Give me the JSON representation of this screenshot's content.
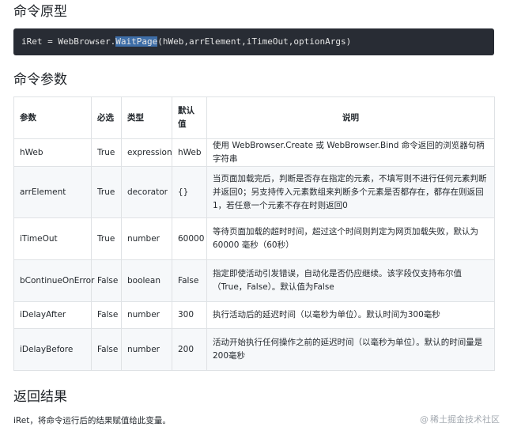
{
  "sections": {
    "prototype_title": "命令原型",
    "params_title": "命令参数",
    "result_title": "返回结果"
  },
  "code": {
    "before": "iRet = WebBrowser.",
    "highlight": "WaitPage",
    "after": "(hWeb,arrElement,iTimeOut,optionArgs)"
  },
  "table": {
    "headers": [
      "参数",
      "必选",
      "类型",
      "默认值",
      "说明"
    ],
    "rows": [
      [
        "hWeb",
        "True",
        "expression",
        "hWeb",
        "使用 WebBrowser.Create 或 WebBrowser.Bind 命令返回的浏览器句柄字符串"
      ],
      [
        "arrElement",
        "True",
        "decorator",
        "{}",
        "当页面加载完后，判断是否存在指定的元素，不填写则不进行任何元素判断并返回0；另支持传入元素数组来判断多个元素是否都存在，都存在则返回1，若任意一个元素不存在时则返回0"
      ],
      [
        "iTimeOut",
        "True",
        "number",
        "60000",
        "等待页面加载的超时时间，超过这个时间则判定为网页加载失败，默认为60000 毫秒（60秒）"
      ],
      [
        "bContinueOnError",
        "False",
        "boolean",
        "False",
        "指定即使活动引发错误，自动化是否仍应继续。该字段仅支持布尔值（True，False）。默认值为False"
      ],
      [
        "iDelayAfter",
        "False",
        "number",
        "300",
        "执行活动后的延迟时间（以毫秒为单位）。默认时间为300毫秒"
      ],
      [
        "iDelayBefore",
        "False",
        "number",
        "200",
        "活动开始执行任何操作之前的延迟时间（以毫秒为单位）。默认的时间量是200毫秒"
      ]
    ]
  },
  "result_text": "iRet，将命令运行后的结果赋值给此变量。",
  "watermark": {
    "at": "@",
    "text": "稀土掘金技术社区"
  }
}
